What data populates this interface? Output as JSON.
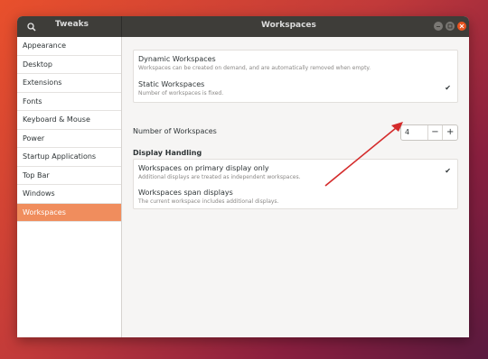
{
  "titlebar": {
    "app_name": "Tweaks",
    "window_title": "Workspaces"
  },
  "sidebar": {
    "items": [
      {
        "label": "Appearance"
      },
      {
        "label": "Desktop"
      },
      {
        "label": "Extensions"
      },
      {
        "label": "Fonts"
      },
      {
        "label": "Keyboard & Mouse"
      },
      {
        "label": "Power"
      },
      {
        "label": "Startup Applications"
      },
      {
        "label": "Top Bar"
      },
      {
        "label": "Windows"
      },
      {
        "label": "Workspaces"
      }
    ],
    "active": "Workspaces"
  },
  "workspaces": {
    "dynamic": {
      "title": "Dynamic Workspaces",
      "subtitle": "Workspaces can be created on demand, and are automatically removed when empty."
    },
    "static": {
      "title": "Static Workspaces",
      "subtitle": "Number of workspaces is fixed.",
      "checked": "✔"
    },
    "number": {
      "label": "Number of Workspaces",
      "value": "4",
      "minus": "−",
      "plus": "+"
    }
  },
  "display_handling": {
    "heading": "Display Handling",
    "primary": {
      "title": "Workspaces on primary display only",
      "subtitle": "Additional displays are treated as independent workspaces.",
      "checked": "✔"
    },
    "span": {
      "title": "Workspaces span displays",
      "subtitle": "The current workspace includes additional displays."
    }
  },
  "colors": {
    "accent": "#f08d5d",
    "annotation_arrow": "#d42b2b",
    "titlebar": "#3e3d39"
  }
}
